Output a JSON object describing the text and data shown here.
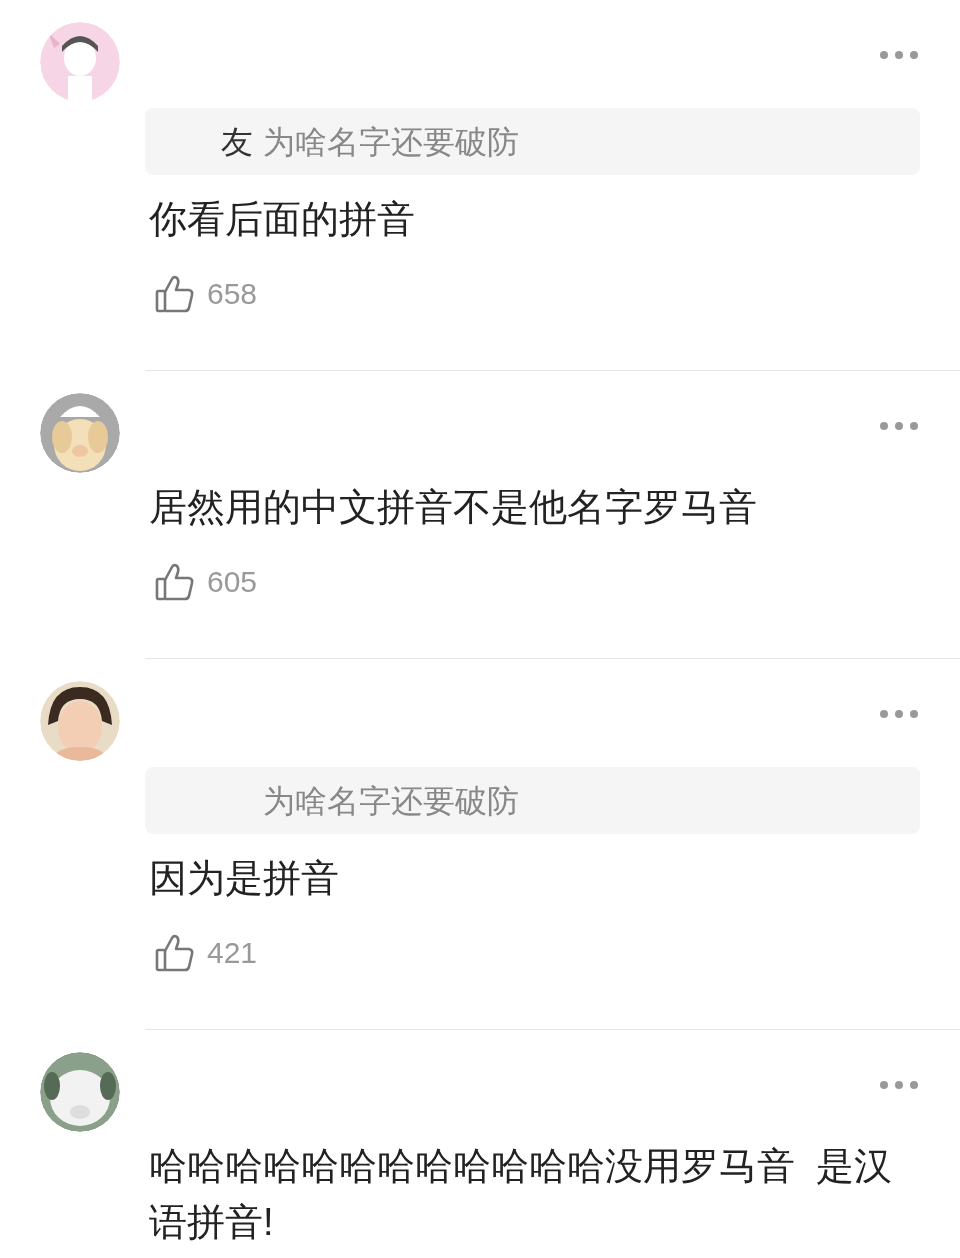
{
  "comments": [
    {
      "quote": {
        "author": "友",
        "text": "为啥名字还要破防"
      },
      "text": "你看后面的拼音",
      "likes": "658"
    },
    {
      "text": "居然用的中文拼音不是他名字罗马音",
      "likes": "605"
    },
    {
      "quote": {
        "text": "为啥名字还要破防"
      },
      "text": "因为是拼音",
      "likes": "421"
    },
    {
      "text": "哈哈哈哈哈哈哈哈哈哈哈哈没用罗马音  是汉语拼音!"
    }
  ]
}
